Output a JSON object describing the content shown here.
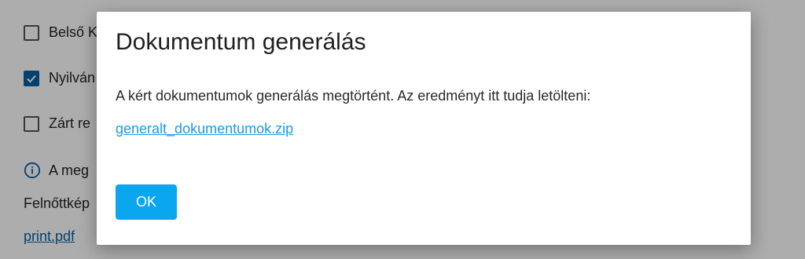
{
  "background": {
    "checkbox_1": {
      "label": "Belső K",
      "checked": false
    },
    "checkbox_2": {
      "label": "Nyilván",
      "checked": true
    },
    "checkbox_3": {
      "label": "Zárt re",
      "checked": false
    },
    "info_text": "A meg",
    "info_icon": "info-circle-icon",
    "subtitle": "Felnőttkép",
    "link": "print.pdf"
  },
  "dialog": {
    "title": "Dokumentum generálás",
    "message": "A kért dokumentumok generálás megtörtént. Az eredményt itt tudja letölteni:",
    "download_link": "generalt_dokumentumok.zip",
    "ok_label": "OK"
  },
  "colors": {
    "accent": "#0aa6f0",
    "link": "#1b9be0",
    "checkbox_checked": "#0a5fa3"
  }
}
